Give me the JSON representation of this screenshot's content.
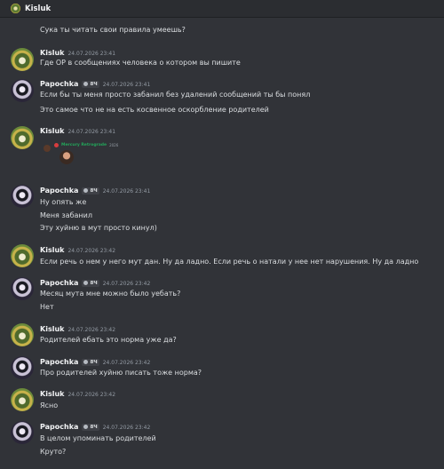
{
  "header": {
    "channel_name": "Kisluk"
  },
  "messages": [
    {
      "author": "",
      "timestamp": "",
      "lines": [
        "Сука ты читать свои правила умеешь?"
      ]
    },
    {
      "author": "Kisluk",
      "timestamp": "24.07.2026 23:41",
      "lines": [
        "Где OP в сообщениях человека о котором вы пишите"
      ]
    },
    {
      "author": "Papochka",
      "badge": "8Ч",
      "timestamp": "24.07.2026 23:41",
      "lines": [
        "Если бы ты меня просто забанил без удалений сообщений ты бы понял",
        "Это самое что не на есть косвенное оскорбление родителей"
      ]
    },
    {
      "author": "Kisluk",
      "timestamp": "24.07.2026 23:41",
      "lines": [],
      "attachment": {
        "name": "Mercury Retrograde",
        "time": "2026"
      }
    },
    {
      "author": "Papochka",
      "badge": "8Ч",
      "timestamp": "24.07.2026 23:41",
      "lines": [
        "Ну опять же",
        "Меня забанил",
        "Эту хуйню в мут просто кинул)"
      ]
    },
    {
      "author": "Kisluk",
      "timestamp": "24.07.2026 23:42",
      "lines": [
        "Если речь о нем у него мут дан. Ну да ладно. Если речь о натали у нее нет нарушения. Ну да ладно"
      ]
    },
    {
      "author": "Papochka",
      "badge": "8Ч",
      "timestamp": "24.07.2026 23:42",
      "lines": [
        "Месяц мута мне можно было уебать?",
        "Нет"
      ]
    },
    {
      "author": "Kisluk",
      "timestamp": "24.07.2026 23:42",
      "lines": [
        "Родителей ебать это норма уже да?"
      ]
    },
    {
      "author": "Papochka",
      "badge": "8Ч",
      "timestamp": "24.07.2026 23:42",
      "lines": [
        "Про родителей хуйню писать тоже норма?"
      ]
    },
    {
      "author": "Kisluk",
      "timestamp": "24.07.2026 23:42",
      "lines": [
        "Ясно"
      ]
    },
    {
      "author": "Papochka",
      "badge": "8Ч",
      "timestamp": "24.07.2026 23:42",
      "lines": [
        "В целом упоминать родителей",
        "Круто?"
      ]
    }
  ]
}
